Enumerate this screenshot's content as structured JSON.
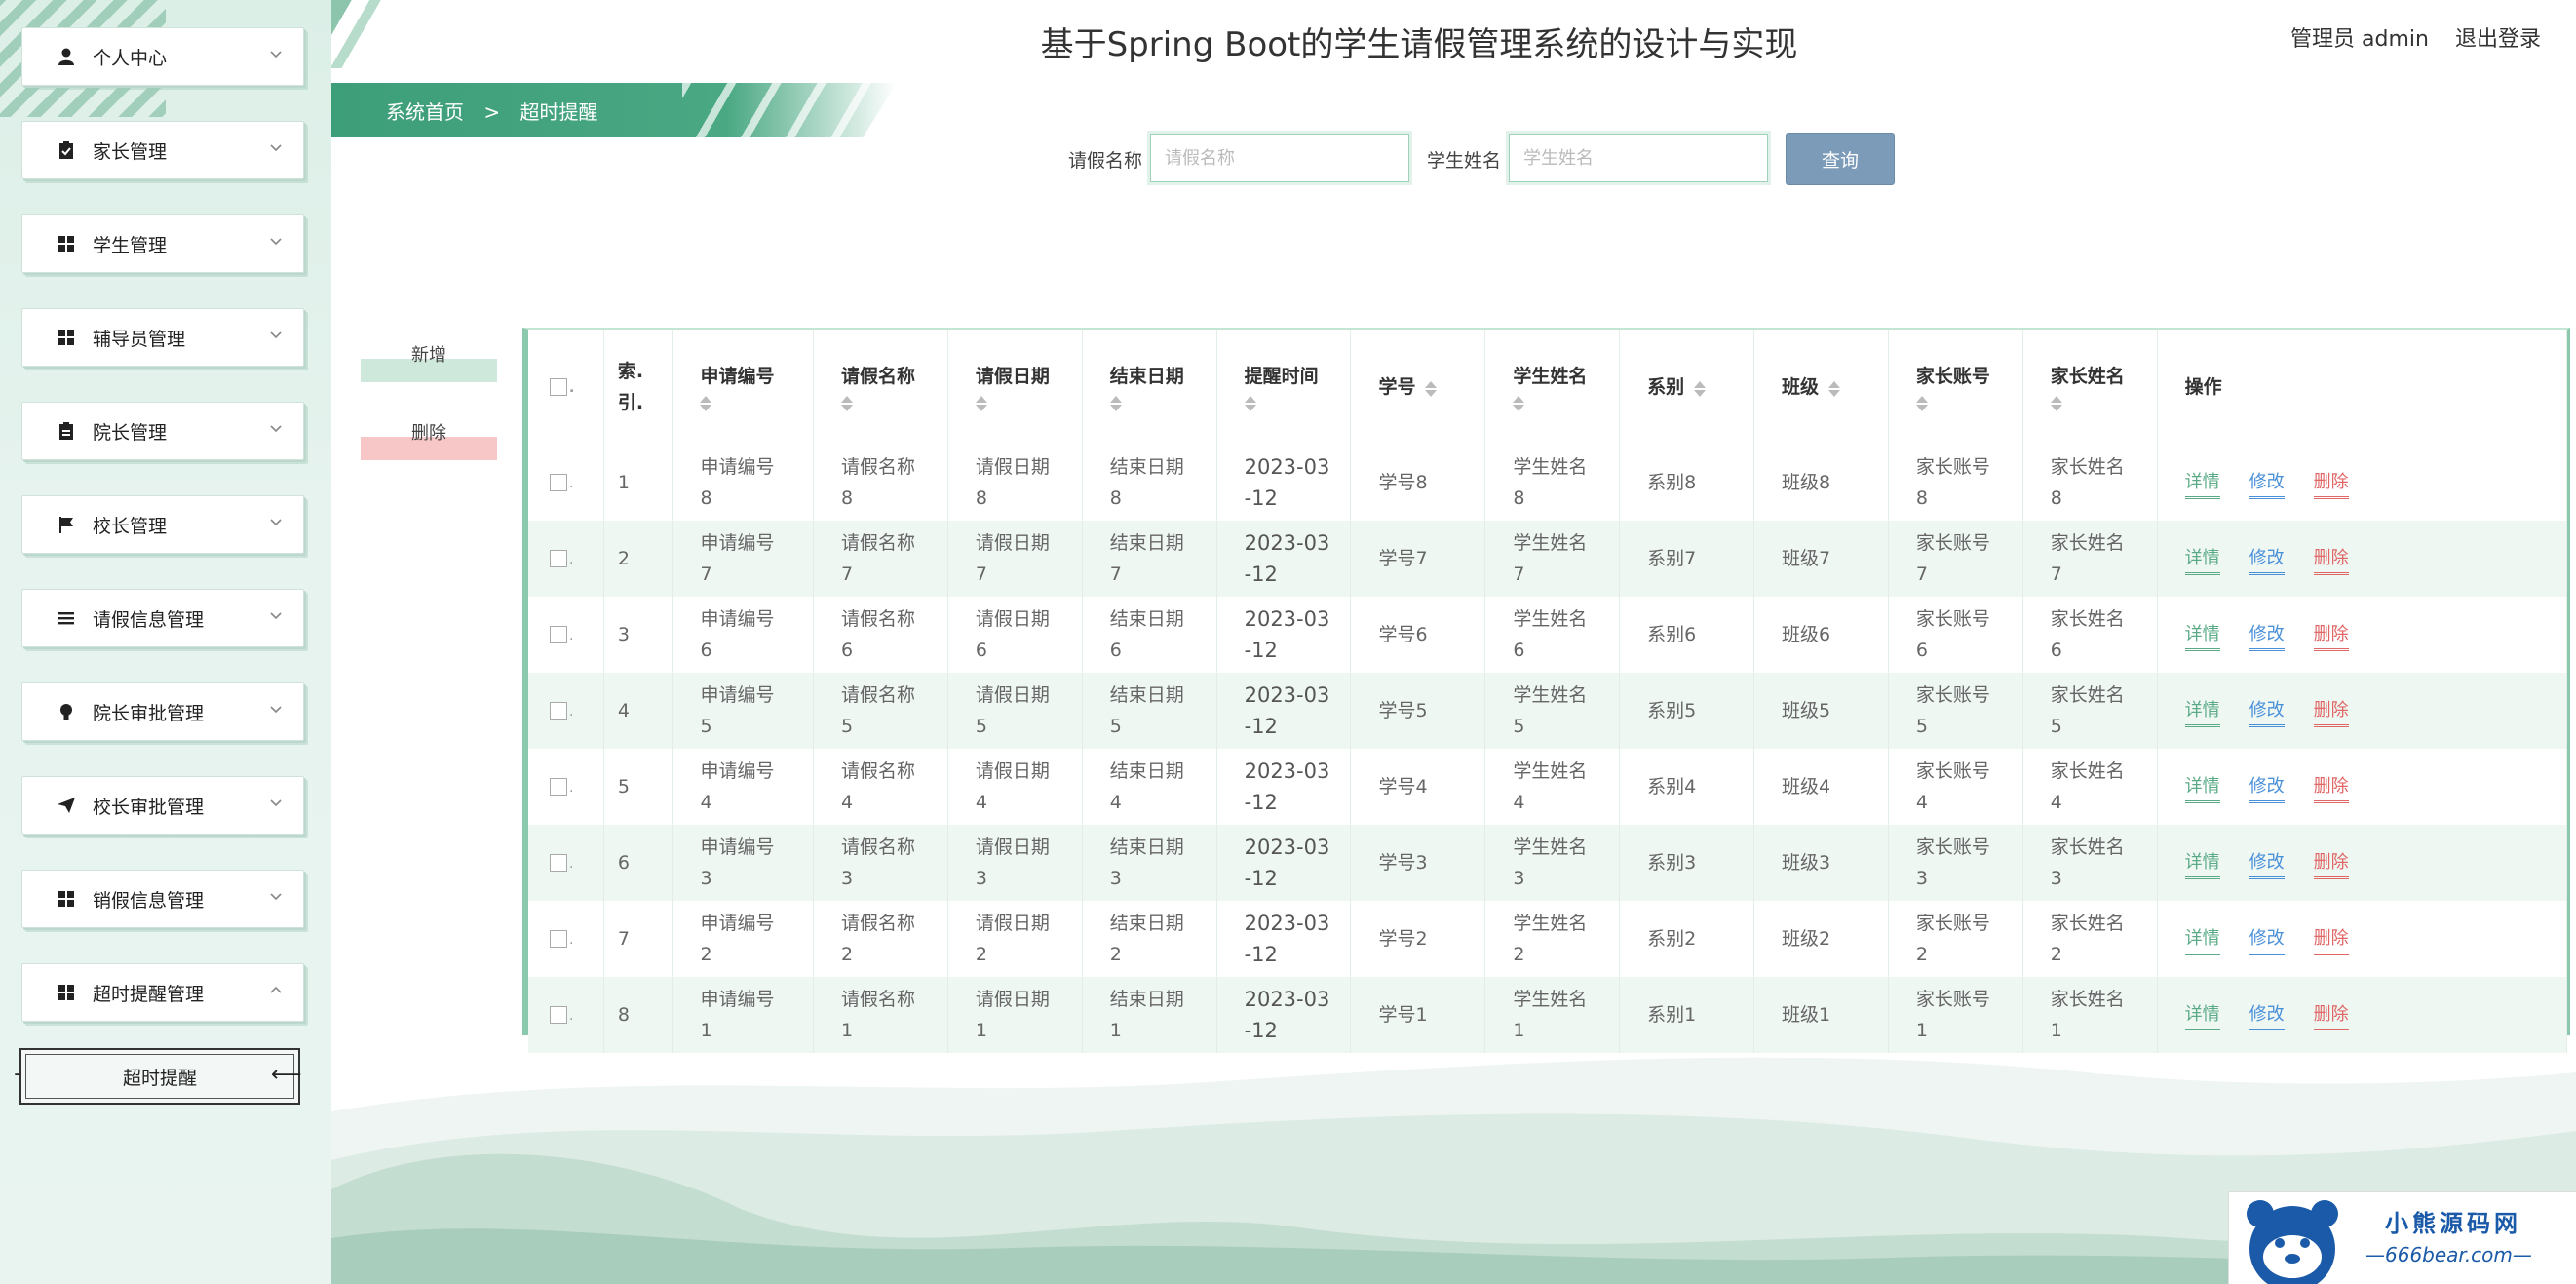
{
  "app": {
    "title": "基于Spring Boot的学生请假管理系统的设计与实现",
    "user_role": "管理员 admin",
    "logout": "退出登录"
  },
  "breadcrumb": {
    "home": "系统首页",
    "separator": ">",
    "current": "超时提醒"
  },
  "sidebar": {
    "items": [
      {
        "label": "个人中心",
        "icon": "person-icon"
      },
      {
        "label": "家长管理",
        "icon": "clipboard-check-icon"
      },
      {
        "label": "学生管理",
        "icon": "grid-icon"
      },
      {
        "label": "辅导员管理",
        "icon": "grid-icon"
      },
      {
        "label": "院长管理",
        "icon": "clipboard-icon"
      },
      {
        "label": "校长管理",
        "icon": "flag-icon"
      },
      {
        "label": "请假信息管理",
        "icon": "list-icon"
      },
      {
        "label": "院长审批管理",
        "icon": "bulb-icon"
      },
      {
        "label": "校长审批管理",
        "icon": "send-icon"
      },
      {
        "label": "销假信息管理",
        "icon": "grid-icon"
      },
      {
        "label": "超时提醒管理",
        "icon": "grid-icon",
        "expanded": true
      }
    ],
    "sub_item": "超时提醒"
  },
  "search": {
    "leave_name_label": "请假名称",
    "leave_name_placeholder": "请假名称",
    "student_name_label": "学生姓名",
    "student_name_placeholder": "学生姓名",
    "query_button": "查询"
  },
  "actions": {
    "add": "新增",
    "delete": "删除"
  },
  "table": {
    "headers": {
      "index_1": "索.",
      "index_2": "引.",
      "app_no": "申请编号",
      "leave_name": "请假名称",
      "leave_date": "请假日期",
      "end_date": "结束日期",
      "remind_time": "提醒时间",
      "student_no": "学号",
      "student_name": "学生姓名",
      "department": "系别",
      "class": "班级",
      "parent_account": "家长账号",
      "parent_name": "家长姓名",
      "ops": "操作"
    },
    "ops": {
      "view": "详情",
      "edit": "修改",
      "delete": "删除"
    },
    "rows": [
      {
        "idx": "1",
        "a1": "申请编号",
        "a2": "8",
        "n1": "请假名称",
        "n2": "8",
        "d1": "请假日期",
        "d2": "8",
        "e1": "结束日期",
        "e2": "8",
        "t1": "2023-03",
        "t2": "-12",
        "sno": "学号8",
        "s1": "学生姓名",
        "s2": "8",
        "dep": "系别8",
        "cls": "班级8",
        "p1": "家长账号",
        "p2": "8",
        "pn1": "家长姓名",
        "pn2": "8"
      },
      {
        "idx": "2",
        "a1": "申请编号",
        "a2": "7",
        "n1": "请假名称",
        "n2": "7",
        "d1": "请假日期",
        "d2": "7",
        "e1": "结束日期",
        "e2": "7",
        "t1": "2023-03",
        "t2": "-12",
        "sno": "学号7",
        "s1": "学生姓名",
        "s2": "7",
        "dep": "系别7",
        "cls": "班级7",
        "p1": "家长账号",
        "p2": "7",
        "pn1": "家长姓名",
        "pn2": "7"
      },
      {
        "idx": "3",
        "a1": "申请编号",
        "a2": "6",
        "n1": "请假名称",
        "n2": "6",
        "d1": "请假日期",
        "d2": "6",
        "e1": "结束日期",
        "e2": "6",
        "t1": "2023-03",
        "t2": "-12",
        "sno": "学号6",
        "s1": "学生姓名",
        "s2": "6",
        "dep": "系别6",
        "cls": "班级6",
        "p1": "家长账号",
        "p2": "6",
        "pn1": "家长姓名",
        "pn2": "6"
      },
      {
        "idx": "4",
        "a1": "申请编号",
        "a2": "5",
        "n1": "请假名称",
        "n2": "5",
        "d1": "请假日期",
        "d2": "5",
        "e1": "结束日期",
        "e2": "5",
        "t1": "2023-03",
        "t2": "-12",
        "sno": "学号5",
        "s1": "学生姓名",
        "s2": "5",
        "dep": "系别5",
        "cls": "班级5",
        "p1": "家长账号",
        "p2": "5",
        "pn1": "家长姓名",
        "pn2": "5"
      },
      {
        "idx": "5",
        "a1": "申请编号",
        "a2": "4",
        "n1": "请假名称",
        "n2": "4",
        "d1": "请假日期",
        "d2": "4",
        "e1": "结束日期",
        "e2": "4",
        "t1": "2023-03",
        "t2": "-12",
        "sno": "学号4",
        "s1": "学生姓名",
        "s2": "4",
        "dep": "系别4",
        "cls": "班级4",
        "p1": "家长账号",
        "p2": "4",
        "pn1": "家长姓名",
        "pn2": "4"
      },
      {
        "idx": "6",
        "a1": "申请编号",
        "a2": "3",
        "n1": "请假名称",
        "n2": "3",
        "d1": "请假日期",
        "d2": "3",
        "e1": "结束日期",
        "e2": "3",
        "t1": "2023-03",
        "t2": "-12",
        "sno": "学号3",
        "s1": "学生姓名",
        "s2": "3",
        "dep": "系别3",
        "cls": "班级3",
        "p1": "家长账号",
        "p2": "3",
        "pn1": "家长姓名",
        "pn2": "3"
      },
      {
        "idx": "7",
        "a1": "申请编号",
        "a2": "2",
        "n1": "请假名称",
        "n2": "2",
        "d1": "请假日期",
        "d2": "2",
        "e1": "结束日期",
        "e2": "2",
        "t1": "2023-03",
        "t2": "-12",
        "sno": "学号2",
        "s1": "学生姓名",
        "s2": "2",
        "dep": "系别2",
        "cls": "班级2",
        "p1": "家长账号",
        "p2": "2",
        "pn1": "家长姓名",
        "pn2": "2"
      },
      {
        "idx": "8",
        "a1": "申请编号",
        "a2": "1",
        "n1": "请假名称",
        "n2": "1",
        "d1": "请假日期",
        "d2": "1",
        "e1": "结束日期",
        "e2": "1",
        "t1": "2023-03",
        "t2": "-12",
        "sno": "学号1",
        "s1": "学生姓名",
        "s2": "1",
        "dep": "系别1",
        "cls": "班级1",
        "p1": "家长账号",
        "p2": "1",
        "pn1": "家长姓名",
        "pn2": "1"
      }
    ]
  },
  "watermark": {
    "cn": "小熊源码网",
    "en": "—666bear.com—"
  },
  "colors": {
    "accent": "#4aa883",
    "query_button": "#7b9bb8",
    "view": "#5aaa86",
    "edit": "#4a90d9",
    "delete": "#e06565"
  }
}
